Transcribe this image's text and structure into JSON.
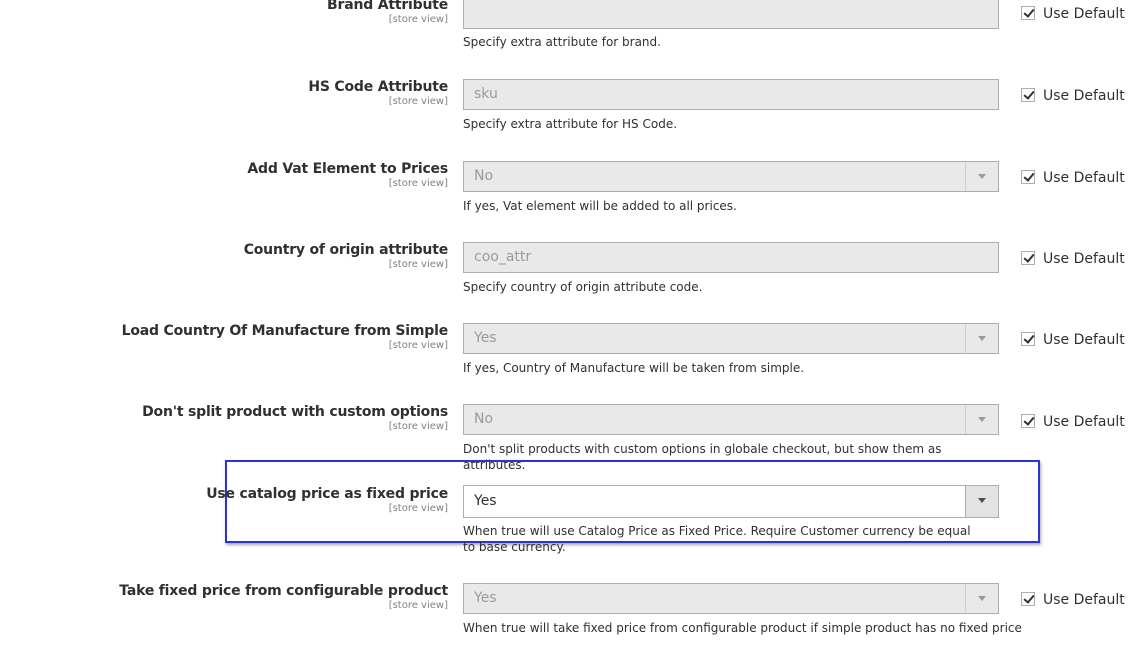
{
  "accent_color": "#2a34d6",
  "fields": [
    {
      "label": "Brand Attribute",
      "scope": "[store view]",
      "value": "",
      "note": "Specify extra attribute for brand.",
      "use_default": "Use Default"
    },
    {
      "label": "HS Code Attribute",
      "scope": "[store view]",
      "value": "sku",
      "note": "Specify extra attribute for HS Code.",
      "use_default": "Use Default"
    },
    {
      "label": "Add Vat Element to Prices",
      "scope": "[store view]",
      "value": "No",
      "note": "If yes, Vat element will be added to all prices.",
      "use_default": "Use Default"
    },
    {
      "label": "Country of origin attribute",
      "scope": "[store view]",
      "value": "coo_attr",
      "note": "Specify country of origin attribute code.",
      "use_default": "Use Default"
    },
    {
      "label": "Load Country Of Manufacture from Simple",
      "scope": "[store view]",
      "value": "Yes",
      "note": "If yes, Country of Manufacture will be taken from simple.",
      "use_default": "Use Default"
    },
    {
      "label": "Don't split product with custom options",
      "scope": "[store view]",
      "value": "No",
      "note": "Don't split products with custom options in globale checkout, but show them as attributes.",
      "use_default": "Use Default"
    },
    {
      "label": "Use catalog price as fixed price",
      "scope": "[store view]",
      "value": "Yes",
      "note": "When true will use Catalog Price as Fixed Price. Require Customer currency be equal to base currency."
    },
    {
      "label": "Take fixed price from configurable product",
      "scope": "[store view]",
      "value": "Yes",
      "note": "When true will take fixed price from configurable product if simple product has no fixed price",
      "use_default": "Use Default"
    }
  ]
}
